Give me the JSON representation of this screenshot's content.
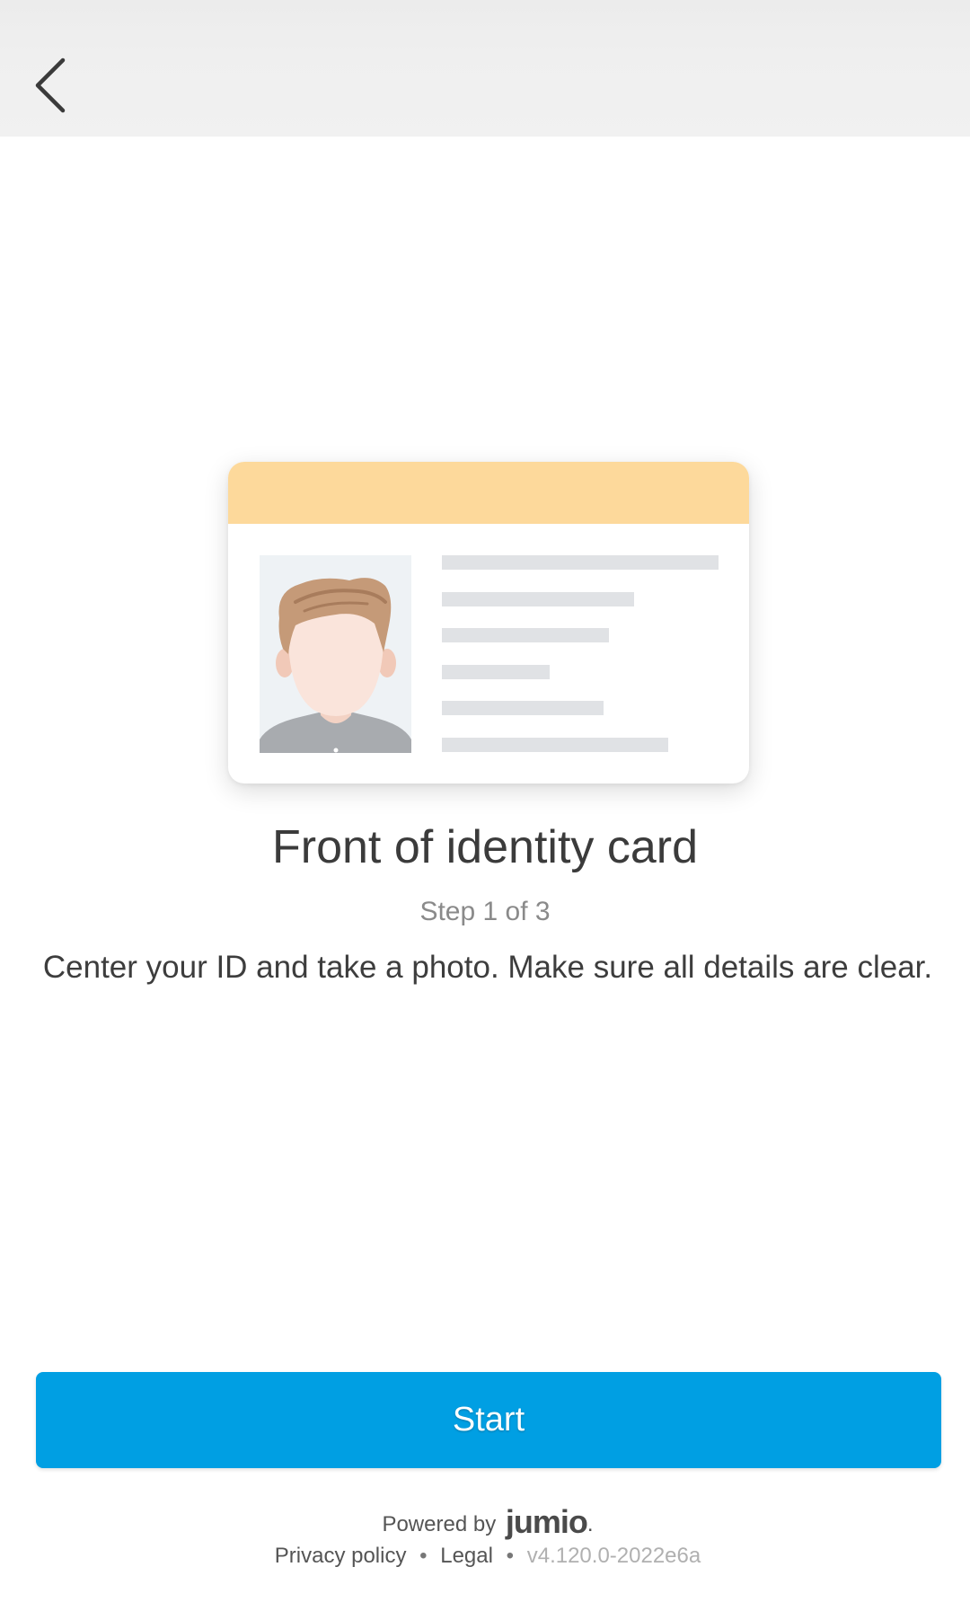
{
  "header": {
    "back_icon": "chevron-left-icon"
  },
  "illustration": {
    "header_color": "#fdd99b",
    "line_color": "#e0e2e5",
    "avatar_icon": "person-avatar-icon"
  },
  "content": {
    "title": "Front of identity card",
    "step": "Step 1 of 3",
    "description": "Center your ID and take a photo. Make sure all details are clear."
  },
  "actions": {
    "start_label": "Start",
    "start_color": "#009fe3"
  },
  "footer": {
    "powered_by": "Powered by",
    "brand": "jumio",
    "brand_dot": ".",
    "privacy_label": "Privacy policy",
    "separator": "•",
    "legal_label": "Legal",
    "version": "v4.120.0-2022e6a"
  }
}
